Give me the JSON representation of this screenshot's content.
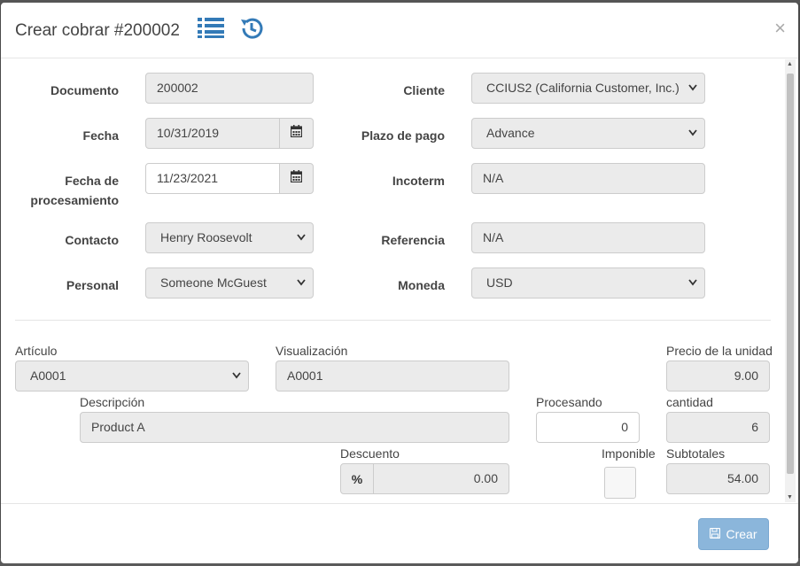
{
  "modal": {
    "title": "Crear cobrar #200002",
    "close_label": "×",
    "header_icons": [
      "list-icon",
      "history-icon"
    ]
  },
  "header_form": {
    "documento": {
      "label": "Documento",
      "value": "200002"
    },
    "fecha": {
      "label": "Fecha",
      "value": "10/31/2019"
    },
    "fecha_procesamiento": {
      "label_line1": "Fecha de",
      "label_line2": "procesamiento",
      "value": "11/23/2021"
    },
    "contacto": {
      "label": "Contacto",
      "value": "Henry Roosevolt"
    },
    "personal": {
      "label": "Personal",
      "value": "Someone McGuest"
    },
    "cliente": {
      "label": "Cliente",
      "value": "CCIUS2 (California Customer, Inc.)"
    },
    "plazo_pago": {
      "label": "Plazo de pago",
      "value": "Advance"
    },
    "incoterm": {
      "label": "Incoterm",
      "value": "N/A"
    },
    "referencia": {
      "label": "Referencia",
      "value": "N/A"
    },
    "moneda": {
      "label": "Moneda",
      "value": "USD"
    }
  },
  "line_item": {
    "articulo": {
      "label": "Artículo",
      "value": "A0001"
    },
    "visualizacion": {
      "label": "Visualización",
      "value": "A0001"
    },
    "precio_unidad": {
      "label": "Precio de la unidad",
      "value": "9.00"
    },
    "descripcion": {
      "label": "Descripción",
      "value": "Product A"
    },
    "procesando": {
      "label": "Procesando",
      "value": "0"
    },
    "cantidad": {
      "label": "cantidad",
      "value": "6"
    },
    "descuento": {
      "label": "Descuento",
      "addon": "%",
      "value": "0.00"
    },
    "imponible": {
      "label": "Imponible",
      "checked": false
    },
    "subtotales": {
      "label": "Subtotales",
      "value": "54.00"
    }
  },
  "footer": {
    "create_label": "Crear"
  },
  "colors": {
    "field_bg": "#ebebeb",
    "icon_blue": "#337ab7",
    "primary_btn": "#8bb6db"
  }
}
